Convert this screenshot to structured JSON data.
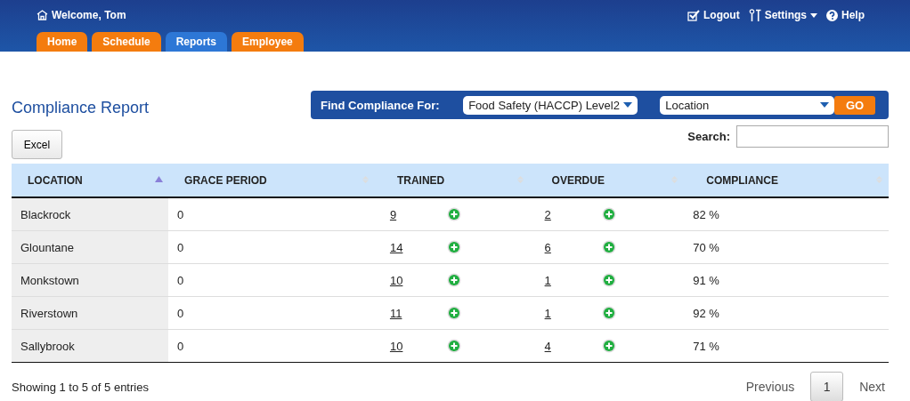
{
  "header": {
    "welcome": "Welcome, Tom",
    "links": [
      {
        "kind": "logout",
        "label": "Logout"
      },
      {
        "kind": "settings",
        "label": "Settings"
      },
      {
        "kind": "help",
        "label": "Help"
      }
    ]
  },
  "tabs": [
    {
      "label": "Home",
      "selected": false
    },
    {
      "label": "Schedule",
      "selected": false
    },
    {
      "label": "Reports",
      "selected": true
    },
    {
      "label": "Employee",
      "selected": false
    }
  ],
  "page_title": "Compliance Report",
  "filter": {
    "label": "Find Compliance For:",
    "course": "Food Safety (HACCP) Level2",
    "location": "Location",
    "go": "GO"
  },
  "excel_button": "Excel",
  "search": {
    "label": "Search:"
  },
  "table": {
    "columns": [
      {
        "label": "LOCATION",
        "sorted": true
      },
      {
        "label": "GRACE PERIOD",
        "sorted": false
      },
      {
        "label": "TRAINED",
        "sorted": false
      },
      {
        "label": "OVERDUE",
        "sorted": false
      },
      {
        "label": "COMPLIANCE",
        "sorted": false
      }
    ],
    "rows": [
      [
        "Blackrock",
        "0",
        "9",
        "2",
        "82 %"
      ],
      [
        "Glountane",
        "0",
        "14",
        "6",
        "70 %"
      ],
      [
        "Monkstown",
        "0",
        "10",
        "1",
        "91 %"
      ],
      [
        "Riverstown",
        "0",
        "11",
        "1",
        "92 %"
      ],
      [
        "Sallybrook",
        "0",
        "10",
        "4",
        "71 %"
      ]
    ]
  },
  "footer": {
    "info": "Showing 1 to 5 of 5 entries",
    "pagination": [
      {
        "label": "Previous",
        "selected": false
      },
      {
        "label": "1",
        "selected": true
      },
      {
        "label": "Next",
        "selected": false
      }
    ]
  }
}
